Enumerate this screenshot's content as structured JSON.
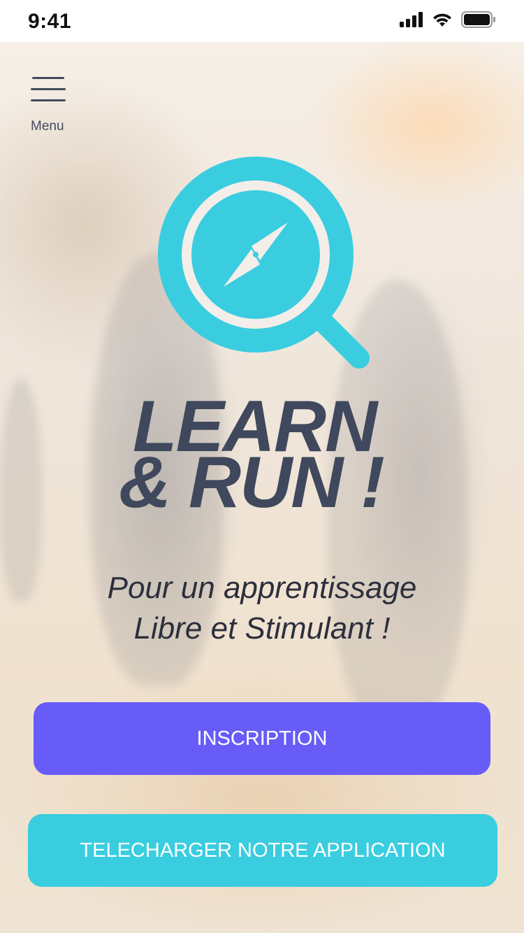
{
  "status_bar": {
    "time": "9:41",
    "icons": [
      "cellular-signal-icon",
      "wifi-icon",
      "battery-icon"
    ]
  },
  "menu": {
    "label": "Menu",
    "icon": "hamburger-menu-icon"
  },
  "logo": {
    "icon": "magnifier-compass-icon"
  },
  "title": {
    "line1": "LEARN",
    "line2": "& RUN !"
  },
  "subtitle": {
    "line1": "Pour un apprentissage",
    "line2": "Libre et Stimulant !"
  },
  "buttons": {
    "inscription": "INSCRIPTION",
    "download": "TELECHARGER NOTRE APPLICATION"
  },
  "colors": {
    "primary_purple": "#685cf8",
    "accent_cyan": "#3acde0",
    "title_slate": "#3f485c"
  }
}
